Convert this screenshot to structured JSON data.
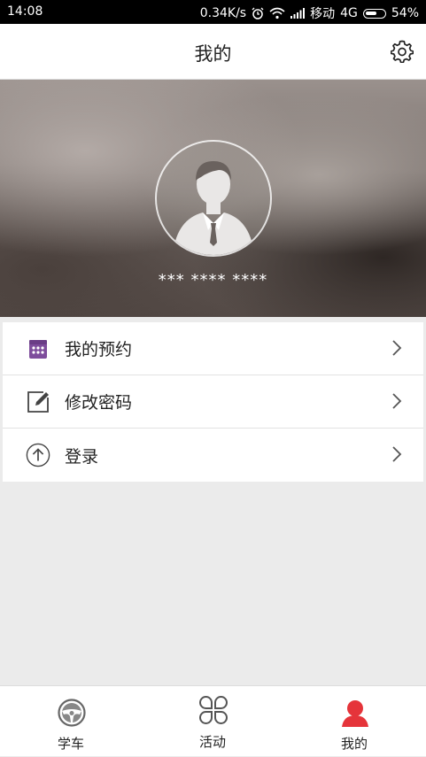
{
  "status_bar": {
    "time": "14:08",
    "net_speed": "0.34K/s",
    "carrier": "移动",
    "network": "4G",
    "battery": "54%"
  },
  "header": {
    "title": "我的",
    "settings_icon": "gear-icon"
  },
  "profile": {
    "avatar_icon": "user-avatar-icon",
    "username": "*** **** ****"
  },
  "menu": {
    "items": [
      {
        "label": "我的预约",
        "icon": "calendar-icon",
        "icon_color": "#7e4d9c"
      },
      {
        "label": "修改密码",
        "icon": "edit-icon",
        "icon_color": "#444444"
      },
      {
        "label": "登录",
        "icon": "arrow-up-circle-icon",
        "icon_color": "#444444"
      }
    ]
  },
  "tabbar": {
    "tabs": [
      {
        "label": "学车",
        "icon": "steering-wheel-icon",
        "active": false
      },
      {
        "label": "活动",
        "icon": "four-circles-icon",
        "active": false
      },
      {
        "label": "我的",
        "icon": "person-icon",
        "active": true
      }
    ],
    "active_color": "#e5343a"
  }
}
